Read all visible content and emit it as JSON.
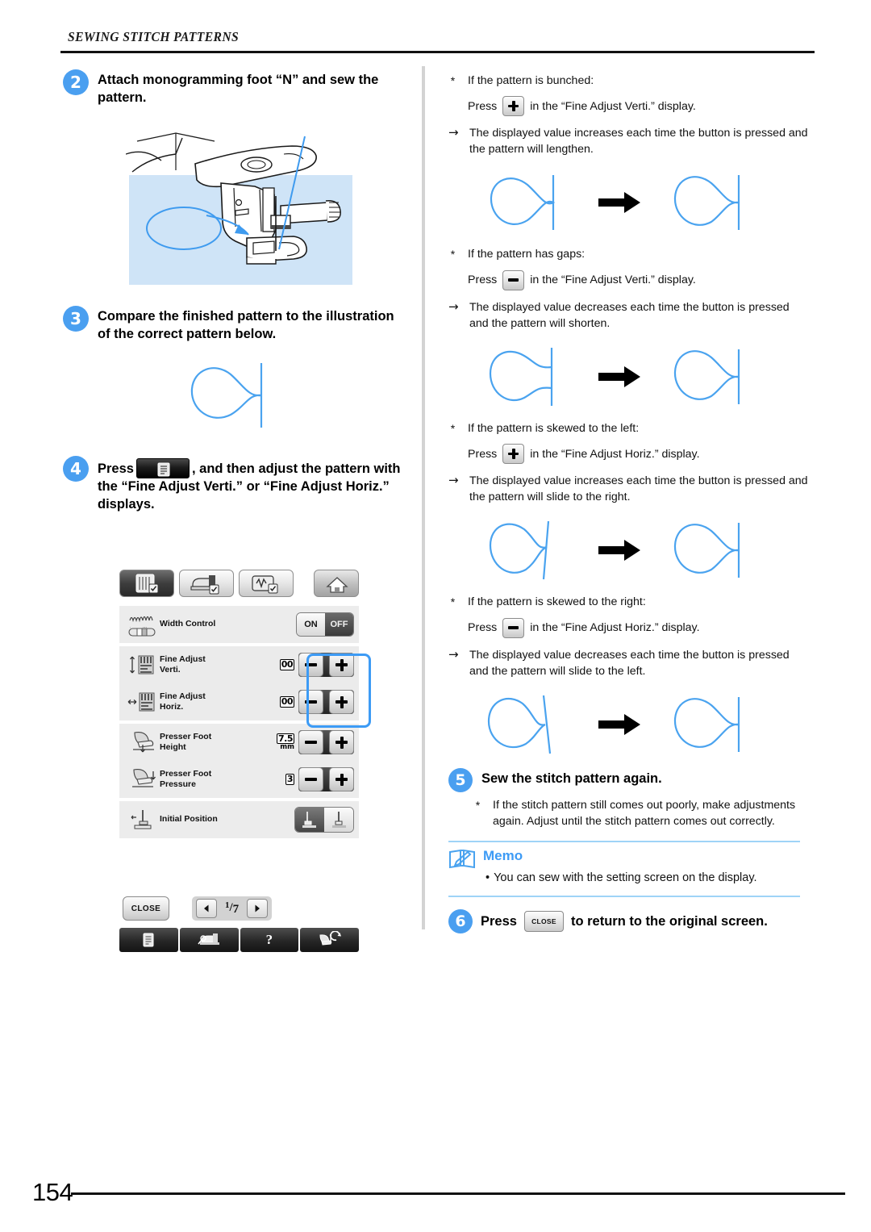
{
  "header": {
    "section_title": "SEWING STITCH PATTERNS"
  },
  "footer": {
    "page_number": "154"
  },
  "left_column": {
    "step2": {
      "number": "2",
      "title": "Attach monogramming foot “N” and sew the pattern."
    },
    "step3": {
      "number": "3",
      "title": "Compare the finished pattern to the illustration of the correct pattern below."
    },
    "step4": {
      "number": "4",
      "title_before": "Press",
      "title_after": ", and then adjust the pattern with the “Fine Adjust Verti.” or “Fine Adjust Horiz.” displays.",
      "button_icon": "settings-page-icon"
    }
  },
  "lcd": {
    "tabs": [
      {
        "name": "tab-sewing-settings",
        "icon": "needle-plate-icon",
        "state": "selected"
      },
      {
        "name": "tab-machine-settings",
        "icon": "sewing-machine-icon",
        "state": "normal"
      },
      {
        "name": "tab-embroidery-settings",
        "icon": "embroidery-unit-icon",
        "state": "normal"
      }
    ],
    "home_button": {
      "icon": "home-icon",
      "label": ""
    },
    "rows": [
      {
        "label": "Width Control",
        "icon": "width-control-icon",
        "control": "toggle",
        "value": "",
        "unit": "",
        "toggle": {
          "on_label": "ON",
          "off_label": "OFF",
          "selected": "OFF"
        }
      },
      {
        "label": "Fine Adjust Verti.",
        "label_line1": "Fine Adjust",
        "label_line2": "Verti.",
        "icon": "fine-adjust-vertical-icon",
        "control": "stepper",
        "value": "00",
        "unit": ""
      },
      {
        "label": "Fine Adjust Horiz.",
        "label_line1": "Fine Adjust",
        "label_line2": "Horiz.",
        "icon": "fine-adjust-horizontal-icon",
        "control": "stepper",
        "value": "00",
        "unit": ""
      },
      {
        "label": "Presser Foot Height",
        "label_line1": "Presser Foot",
        "label_line2": "Height",
        "icon": "presser-foot-height-icon",
        "control": "stepper",
        "value": "7.5",
        "unit": "mm"
      },
      {
        "label": "Presser Foot Pressure",
        "label_line1": "Presser Foot",
        "label_line2": "Pressure",
        "icon": "presser-foot-pressure-icon",
        "control": "stepper",
        "value": "3",
        "unit": ""
      },
      {
        "label": "Initial Position",
        "label_line1": "Initial Position",
        "label_line2": "",
        "icon": "initial-position-icon",
        "control": "segmented",
        "value": "",
        "unit": ""
      }
    ],
    "stepper": {
      "minus_label": "−",
      "plus_label": "+"
    },
    "close_button": "CLOSE",
    "pager": {
      "current": "1",
      "separator": "/",
      "total": "7",
      "prev_icon": "triangle-left-icon",
      "next_icon": "triangle-right-icon"
    },
    "taskbar": [
      {
        "name": "taskbar-settings",
        "icon": "settings-page-icon",
        "label": ""
      },
      {
        "name": "taskbar-machine-guide",
        "icon": "sewing-machine-icon",
        "label": ""
      },
      {
        "name": "taskbar-help",
        "icon": "question-mark-icon",
        "label": "?"
      },
      {
        "name": "taskbar-operation-guide",
        "icon": "presser-foot-rotate-icon",
        "label": ""
      }
    ],
    "highlight_color": "#3d9bf5"
  },
  "right_column": {
    "cases": [
      {
        "bullet": "*",
        "condition": "If the pattern is bunched:",
        "press_prefix": "Press",
        "press_button": "plus",
        "press_suffix": "in the “Fine Adjust Verti.” display.",
        "arrow": "→",
        "result": "The displayed value increases each time the button is pressed and the pattern will lengthen.",
        "figure_before": "bunched",
        "figure_after": "correct"
      },
      {
        "bullet": "*",
        "condition": "If the pattern has gaps:",
        "press_prefix": "Press",
        "press_button": "minus",
        "press_suffix": "in the “Fine Adjust Verti.” display.",
        "arrow": "→",
        "result": "The displayed value decreases each time the button is pressed and the pattern will shorten.",
        "figure_before": "gaps",
        "figure_after": "correct"
      },
      {
        "bullet": "*",
        "condition": "If the pattern is skewed to the left:",
        "press_prefix": "Press",
        "press_button": "plus",
        "press_suffix": "in the “Fine Adjust Horiz.” display.",
        "arrow": "→",
        "result": "The displayed value increases each time the button is pressed and the pattern will slide to the right.",
        "figure_before": "skew-left",
        "figure_after": "correct"
      },
      {
        "bullet": "*",
        "condition": "If the pattern is skewed to the right:",
        "press_prefix": "Press",
        "press_button": "minus",
        "press_suffix": "in the “Fine Adjust Horiz.” display.",
        "arrow": "→",
        "result": "The displayed value decreases each time the button is pressed and the pattern will slide to the left.",
        "figure_before": "skew-right",
        "figure_after": "correct"
      }
    ],
    "step5": {
      "number": "5",
      "title": "Sew the stitch pattern again.",
      "bullet": "*",
      "note": "If the stitch pattern still comes out poorly, make adjustments again. Adjust until the stitch pattern comes out correctly."
    },
    "memo": {
      "title": "Memo",
      "icon": "memo-book-pencil-icon",
      "bullet": "•",
      "text": "You can sew with the setting screen on the display."
    },
    "step6": {
      "number": "6",
      "text_before": "Press",
      "button_label": "CLOSE",
      "text_after": "to return to the original screen."
    }
  },
  "colors": {
    "accent_blue": "#4a9ff0",
    "illustration_blue": "#4aa3ef",
    "memo_rule": "#9fd4f7"
  }
}
